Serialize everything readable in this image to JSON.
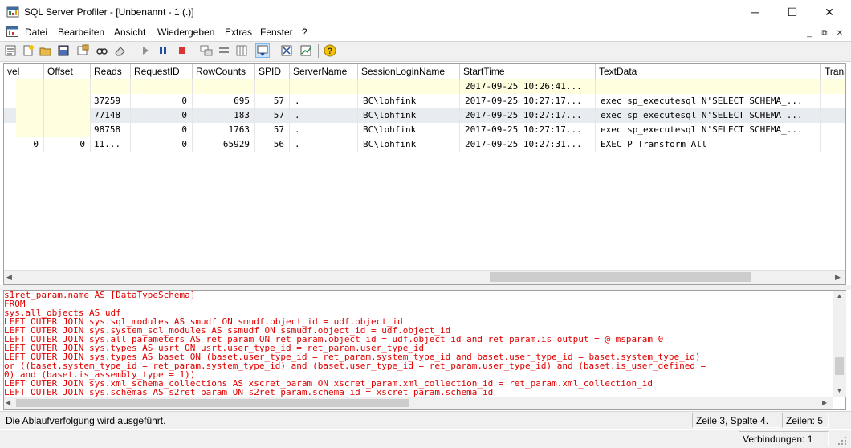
{
  "window": {
    "title": "SQL Server Profiler - [Unbenannt - 1 (.)]",
    "minimize_glyph": "─",
    "maximize_glyph": "☐",
    "close_glyph": "✕"
  },
  "menu": {
    "items": [
      "Datei",
      "Bearbeiten",
      "Ansicht",
      "Wiedergeben",
      "Extras",
      "Fenster",
      "?"
    ],
    "mdi_minimize": "_",
    "mdi_restore": "⧉",
    "mdi_close": "✕"
  },
  "toolbar": {
    "icons": [
      "properties-icon",
      "new-trace-icon",
      "open-icon",
      "save-icon",
      "template-icon",
      "find-icon",
      "clear-icon",
      "run-icon",
      "pause-icon",
      "stop-icon",
      "filter-icon",
      "group-icon",
      "column-icon",
      "autoscroll-icon",
      "replay-icon",
      "chart-icon",
      "help-icon"
    ]
  },
  "grid": {
    "columns": [
      "vel",
      "Offset",
      "Reads",
      "RequestID",
      "RowCounts",
      "SPID",
      "ServerName",
      "SessionLoginName",
      "StartTime",
      "TextData",
      "Trans"
    ],
    "rows": [
      {
        "vel": "",
        "offset": "",
        "reads": "",
        "requestid": "",
        "rowcounts": "",
        "spid": "",
        "servername": "",
        "login": "",
        "starttime": "2017-09-25 10:26:41...",
        "textdata": "",
        "style": "highlight"
      },
      {
        "vel": "",
        "offset": "",
        "reads": "37259",
        "requestid": "0",
        "rowcounts": "695",
        "spid": "57",
        "servername": ".",
        "login": "BC\\lohfink",
        "starttime": "2017-09-25 10:27:17...",
        "textdata": "exec sp_executesql N'SELECT SCHEMA_...",
        "style": "normal"
      },
      {
        "vel": "",
        "offset": "",
        "reads": "77148",
        "requestid": "0",
        "rowcounts": "183",
        "spid": "57",
        "servername": ".",
        "login": "BC\\lohfink",
        "starttime": "2017-09-25 10:27:17...",
        "textdata": "exec sp_executesql N'SELECT SCHEMA_...",
        "style": "selected"
      },
      {
        "vel": "",
        "offset": "",
        "reads": "98758",
        "requestid": "0",
        "rowcounts": "1763",
        "spid": "57",
        "servername": ".",
        "login": "BC\\lohfink",
        "starttime": "2017-09-25 10:27:17...",
        "textdata": "exec sp_executesql N'SELECT SCHEMA_...",
        "style": "normal"
      },
      {
        "vel": "0",
        "offset": "0",
        "reads": "11...",
        "requestid": "0",
        "rowcounts": "65929",
        "spid": "56",
        "servername": ".",
        "login": "BC\\lohfink",
        "starttime": "2017-09-25 10:27:31...",
        "textdata": "EXEC P_Transform_All",
        "style": "normal"
      }
    ]
  },
  "sql_text": [
    "s1ret_param.name AS [DataTypeSchema]",
    "FROM",
    "sys.all_objects AS udf",
    "LEFT OUTER JOIN sys.sql_modules AS smudf ON smudf.object_id = udf.object_id",
    "LEFT OUTER JOIN sys.system_sql_modules AS ssmudf ON ssmudf.object_id = udf.object_id",
    "LEFT OUTER JOIN sys.all_parameters AS ret_param ON ret_param.object_id = udf.object_id and ret_param.is_output = @_msparam_0",
    "LEFT OUTER JOIN sys.types AS usrt ON usrt.user_type_id = ret_param.user_type_id",
    "LEFT OUTER JOIN sys.types AS baset ON (baset.user_type_id = ret_param.system_type_id and baset.user_type_id = baset.system_type_id)",
    "or ((baset.system_type_id = ret_param.system_type_id) and (baset.user_type_id = ret_param.user_type_id) and (baset.is_user_defined =",
    "0) and (baset.is_assembly_type = 1))",
    "LEFT OUTER JOIN sys.xml_schema_collections AS xscret_param ON xscret_param.xml_collection_id = ret_param.xml_collection_id",
    "LEFT OUTER JOIN sys.schemas AS s2ret_param ON s2ret_param.schema_id = xscret_param.schema_id"
  ],
  "status": {
    "message": "Die Ablaufverfolgung wird ausgeführt.",
    "position": "Zeile 3, Spalte 4.",
    "rows": "Zeilen: 5",
    "connections": "Verbindungen: 1"
  },
  "colors": {
    "sql_text": "#e00000",
    "highlight_row": "#ffffe0",
    "selected_row": "#e8ecf0"
  }
}
